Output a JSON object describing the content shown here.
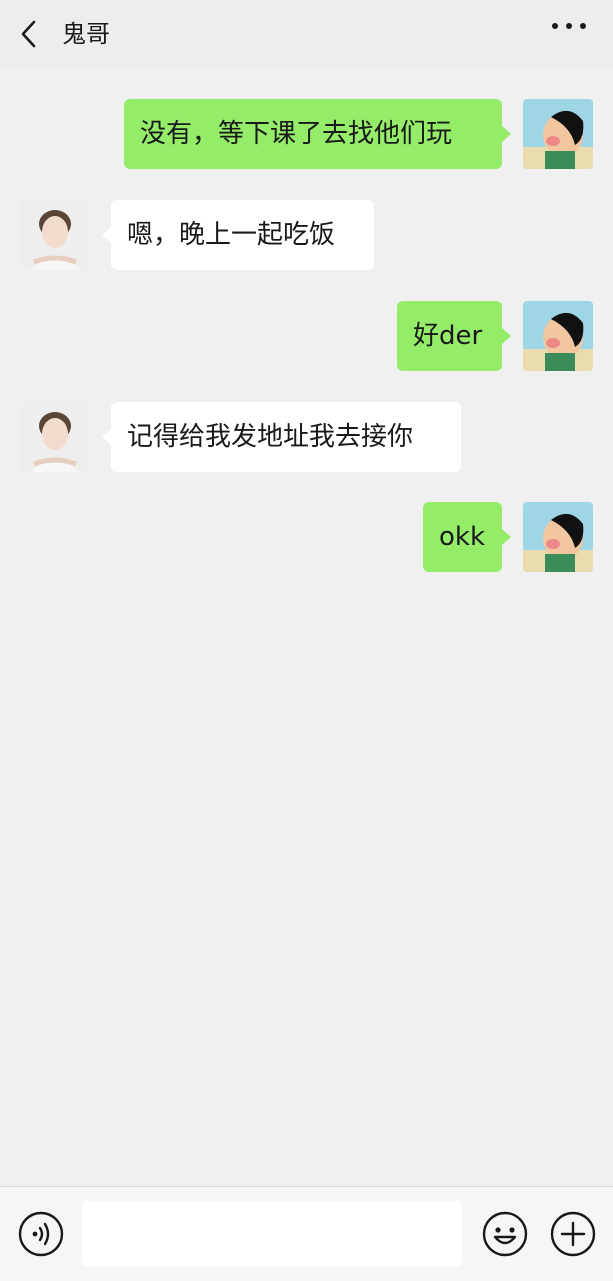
{
  "header": {
    "title": "鬼哥",
    "back_icon": "chevron-left-icon",
    "more_icon": "more-dots-icon"
  },
  "messages": [
    {
      "sender": "me",
      "text": "没有，等下课了去找他们玩"
    },
    {
      "sender": "them",
      "text": "嗯，晚上一起吃饭"
    },
    {
      "sender": "me",
      "text": "好der"
    },
    {
      "sender": "them",
      "text": "记得给我发地址我去接你"
    },
    {
      "sender": "me",
      "text": "okk"
    }
  ],
  "input_bar": {
    "voice_icon": "voice-icon",
    "input_value": "",
    "emoji_icon": "emoji-icon",
    "plus_icon": "plus-icon"
  },
  "colors": {
    "my_bubble": "#95ec69",
    "their_bubble": "#ffffff",
    "background": "#f0f0f0",
    "header": "#ededed"
  }
}
